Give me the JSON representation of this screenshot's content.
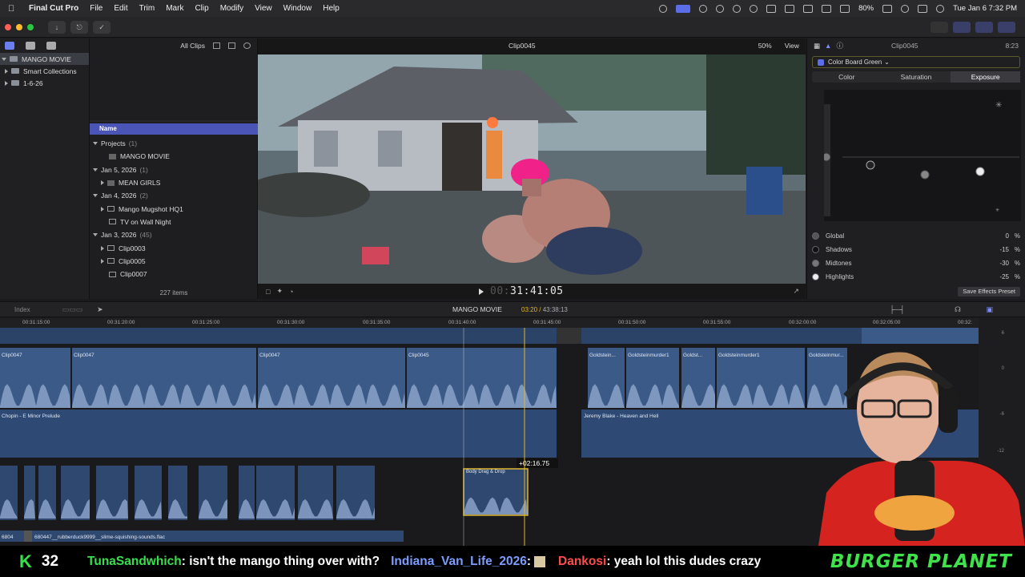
{
  "menubar": {
    "app": "Final Cut Pro",
    "menus": [
      "File",
      "Edit",
      "Trim",
      "Mark",
      "Clip",
      "Modify",
      "View",
      "Window",
      "Help"
    ],
    "battery": "80%",
    "clock": "Tue Jan 6  7:32 PM"
  },
  "library": {
    "items": [
      {
        "label": "MANGO MOVIE"
      },
      {
        "label": "Smart Collections"
      },
      {
        "label": "1-6-26"
      }
    ]
  },
  "browser": {
    "filter": "All Clips",
    "column_header": "Name",
    "rows": [
      {
        "label": "Projects",
        "count": "(1)"
      },
      {
        "label": "MANGO MOVIE",
        "count": ""
      },
      {
        "label": "Jan 5, 2026",
        "count": "(1)"
      },
      {
        "label": "MEAN GIRLS",
        "count": ""
      },
      {
        "label": "Jan 4, 2026",
        "count": "(2)"
      },
      {
        "label": "Mango Mugshot HQ1",
        "count": ""
      },
      {
        "label": "TV on Wall Night",
        "count": ""
      },
      {
        "label": "Jan 3, 2026",
        "count": "(45)"
      },
      {
        "label": "Clip0003",
        "count": ""
      },
      {
        "label": "Clip0005",
        "count": ""
      },
      {
        "label": "Clip0007",
        "count": ""
      }
    ],
    "item_count": "227 items"
  },
  "viewer": {
    "clip_name": "Clip0045",
    "zoom": "50%",
    "view_label": "View",
    "timecode_dim": "00:",
    "timecode": "31:41:05"
  },
  "inspector": {
    "clip_name": "Clip0045",
    "duration": "8:23",
    "effect": "Color Board Green",
    "tabs": [
      "Color",
      "Saturation",
      "Exposure"
    ],
    "active_tab": "Exposure",
    "rows": [
      {
        "label": "Global",
        "value": "0",
        "unit": "%"
      },
      {
        "label": "Shadows",
        "value": "-15",
        "unit": "%"
      },
      {
        "label": "Midtones",
        "value": "-30",
        "unit": "%"
      },
      {
        "label": "Highlights",
        "value": "-25",
        "unit": "%"
      }
    ],
    "save_preset": "Save Effects Preset"
  },
  "timeline": {
    "index_label": "Index",
    "project": "MANGO MOVIE",
    "position": "03:20",
    "total": "43:38:13",
    "ruler": [
      "00:31:15:00",
      "00:31:20:00",
      "00:31:25:00",
      "00:31:30:00",
      "00:31:35:00",
      "00:31:40:00",
      "00:31:45:00",
      "00:31:50:00",
      "00:31:55:00",
      "00:32:00:00",
      "00:32:05:00",
      "00:32:"
    ],
    "video_clips": [
      "Clip0047",
      "Clip0047",
      "Clip0047",
      "Clip0045"
    ],
    "gold_clips": [
      "Goldstein...",
      "Goldsteinmurder1",
      "Goldst...",
      "Goldsteinmurder1",
      "Goldsteinmur..."
    ],
    "music_1": "Chopin - E Minor Prelude",
    "music_2": "Jeremy Blake - Heaven and Hell",
    "drag_clip": "Body Drag & Drop",
    "drag_offset": "+02:16.75",
    "sfx_clip_a": "680447__rubberduck9999__slime-squishing-sounds.flac",
    "sfx_clip_b": "6804"
  },
  "meter_labels": [
    "6",
    "0",
    "-6",
    "-12"
  ],
  "ticker": {
    "k_count": "32",
    "messages": [
      {
        "user": "TunaSandwhich",
        "text": ": isn't the mango thing over with?"
      },
      {
        "user": "Indiana_Van_Life_2026",
        "text": ":"
      },
      {
        "user": "Dankosi",
        "text": ": yeah lol this dudes crazy"
      }
    ],
    "brand": "BURGER PLANET"
  },
  "colors": {
    "accent_blue": "#4b55b8",
    "playhead": "#e0b62d",
    "video_clip": "#3b5a88",
    "audio_clip": "#2e4a74",
    "ticker_green": "#39e04d"
  }
}
